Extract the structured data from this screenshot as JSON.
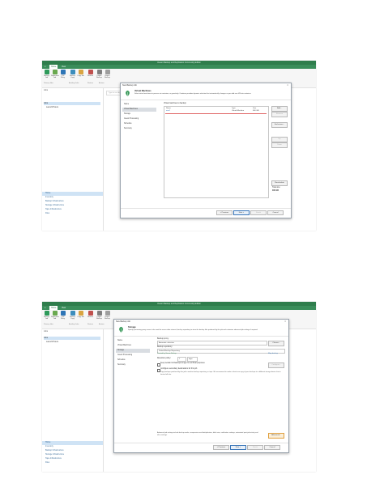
{
  "colors": {
    "brand_green": "#2f7d4c",
    "menu_green": "#3a8d5a",
    "selection": "#cfe3f5",
    "link_blue": "#2b6cb0"
  },
  "app": {
    "title": "Veeam Backup and Replication Community Edition",
    "menu": {
      "file": "≡",
      "tab1": "Home",
      "tab2": "View"
    },
    "ribbon": {
      "buttons": [
        {
          "label": "Backup Job",
          "icon": "backup-job-icon",
          "color": "#2e9a5a"
        },
        {
          "label": "Replication Job",
          "icon": "replication-job-icon",
          "color": "#6aa84f"
        },
        {
          "label": "CDP Policy",
          "icon": "cdp-policy-icon",
          "color": "#2e75b6"
        },
        {
          "label": "Backup Copy",
          "icon": "backup-copy-icon",
          "color": "#3c8dbc"
        },
        {
          "label": "Copy Job",
          "icon": "copy-job-icon",
          "color": "#d9a441"
        },
        {
          "label": "Restore",
          "icon": "restore-icon",
          "color": "#c0504d"
        },
        {
          "label": "Import Backup",
          "icon": "import-backup-icon",
          "color": "#7f7f7f"
        },
        {
          "label": "Export Backup",
          "icon": "export-backup-icon",
          "color": "#9e9e9e"
        }
      ],
      "groups": [
        "Primary Jobs",
        "Auxiliary Jobs",
        "Restore",
        "Actions"
      ]
    },
    "nav": {
      "header": "Jobs",
      "tree": [
        "Jobs",
        "Last 24 Hours"
      ],
      "bottom": [
        "Home",
        "Inventory",
        "Backup Infrastructure",
        "Storage Infrastructure",
        "Tape Infrastructure",
        "Files"
      ]
    },
    "search_placeholder": "Type in an object name to search for",
    "description_label": "Description"
  },
  "dialog1": {
    "title": "New Backup Job",
    "header_title": "Virtual Machines",
    "header_sub": "Select virtual machines to process via container, or granularly. Container provides dynamic selection that automatically changes as you add new VM into container.",
    "steps": [
      "Name",
      "Virtual Machines",
      "Storage",
      "Guest Processing",
      "Schedule",
      "Summary"
    ],
    "current_step": 1,
    "list_label": "Virtual machines to backup:",
    "columns": [
      "Name",
      "Type",
      "Size"
    ],
    "rows": [
      {
        "name": "arm1",
        "type": "Virtual Machine",
        "size": "400 GB"
      }
    ],
    "side_buttons": [
      "Add...",
      "Remove",
      "Exclusions...",
      "Up",
      "Down",
      "Recalculate"
    ],
    "total_label": "Total size:",
    "total_value": "400 GB",
    "buttons": {
      "previous": "< Previous",
      "next": "Next >",
      "finish": "Finish",
      "cancel": "Cancel"
    }
  },
  "dialog2": {
    "title": "New Backup Job",
    "header_title": "Storage",
    "header_sub": "Specify processing proxy server to be used for source data retrieval, backup repository to store the backup files produced by this job and customize advanced job settings if required.",
    "steps": [
      "Name",
      "Virtual Machines",
      "Storage",
      "Guest Processing",
      "Schedule",
      "Summary"
    ],
    "current_step": 2,
    "proxy_label": "Backup proxy:",
    "proxy_value": "Automatic selection",
    "choose_button": "Choose...",
    "repo_label": "Backup repository:",
    "repo_value": "Default Backup Repository",
    "repo_free": "Created by Veeam Backup",
    "map_link": "Map backup",
    "retention_label": "Retention policy:",
    "retention_value": "7",
    "retention_unit": "days",
    "keep_label": "Keep certain full backups longer for archival purposes",
    "configure_button": "Configure...",
    "secondary_label": "Configure secondary destinations for this job",
    "secondary_note": "Copy backups produced by this job to another backup repository, or tape. We recommend to make at least one copy of your backups to a different storage device that is located off-site.",
    "advanced_note": "Advanced job settings include backup mode, compression and deduplication, block size, notification settings, automated post-job activity and other settings.",
    "advanced_button": "Advanced...",
    "buttons": {
      "previous": "< Previous",
      "next": "Next >",
      "finish": "Finish",
      "cancel": "Cancel"
    }
  }
}
